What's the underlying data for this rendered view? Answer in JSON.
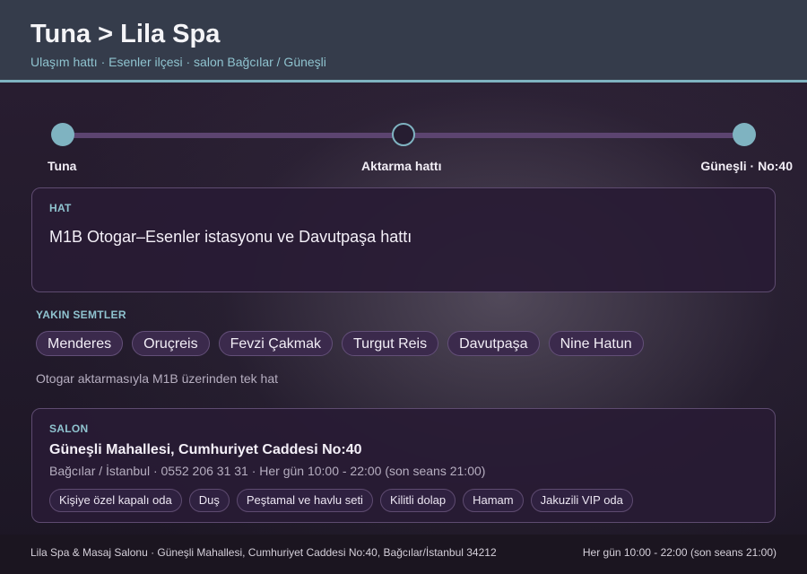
{
  "header": {
    "title": "Tuna > Lila Spa",
    "subtitle": "Ulaşım hattı · Esenler ilçesi · salon Bağcılar / Güneşli"
  },
  "timeline": {
    "stops": [
      {
        "label": "Tuna",
        "state": "filled"
      },
      {
        "label": "Aktarma hattı",
        "state": "hollow"
      },
      {
        "label": "Güneşli · No:40",
        "state": "filled"
      }
    ]
  },
  "line_card": {
    "label": "HAT",
    "value": "M1B Otogar–Esenler istasyonu ve Davutpaşa hattı"
  },
  "nearby": {
    "label": "YAKIN SEMTLER",
    "items": [
      "Menderes",
      "Oruçreis",
      "Fevzi Çakmak",
      "Turgut Reis",
      "Davutpaşa",
      "Nine Hatun"
    ],
    "note": "Otogar aktarmasıyla M1B üzerinden tek hat"
  },
  "salon": {
    "label": "SALON",
    "title": "Güneşli Mahallesi, Cumhuriyet Caddesi No:40",
    "info": "Bağcılar / İstanbul · 0552 206 31 31 · Her gün 10:00 - 22:00 (son seans 21:00)",
    "amenities": [
      "Kişiye özel kapalı oda",
      "Duş",
      "Peştamal ve havlu seti",
      "Kilitli dolap",
      "Hamam",
      "Jakuzili VIP oda"
    ]
  },
  "footer": {
    "left": "Lila Spa & Masaj Salonu · Güneşli Mahallesi, Cumhuriyet Caddesi No:40, Bağcılar/İstanbul 34212",
    "right": "Her gün 10:00 - 22:00 (son seans 21:00)"
  },
  "colors": {
    "accent": "#7fb3c1",
    "header_bg": "#353c4b",
    "track": "#5c4470",
    "card_bg": "#281b34"
  }
}
